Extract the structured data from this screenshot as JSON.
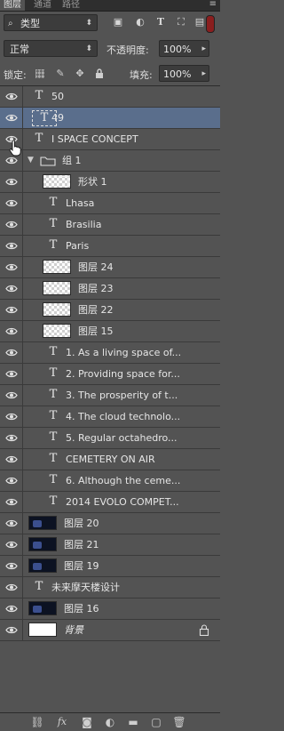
{
  "tabs": [
    {
      "label": "图层",
      "active": true
    },
    {
      "label": "通道",
      "active": false
    },
    {
      "label": "路径",
      "active": false
    }
  ],
  "panel_menu_icon": "panel-menu-icon",
  "filter": {
    "kind_label": "类型",
    "icons": [
      "pixel-filter-icon",
      "adjustment-filter-icon",
      "type-filter-icon",
      "shape-filter-icon",
      "smart-object-filter-icon"
    ]
  },
  "blend": {
    "mode": "正常",
    "opacity_label": "不透明度:",
    "opacity_value": "100%"
  },
  "lock": {
    "label": "锁定:",
    "fill_label": "填充:",
    "fill_value": "100%"
  },
  "layers": [
    {
      "kind": "text",
      "name": "50",
      "indent": 0,
      "selected": false
    },
    {
      "kind": "text",
      "name": "49",
      "indent": 0,
      "selected": true,
      "boxed": true
    },
    {
      "kind": "text",
      "name": "I  SPACE CONCEPT",
      "indent": 0,
      "selected": false
    },
    {
      "kind": "group",
      "name": "组 1",
      "indent": 0,
      "selected": false
    },
    {
      "kind": "shape",
      "name": "形状 1",
      "indent": 1,
      "selected": false
    },
    {
      "kind": "text",
      "name": "Lhasa",
      "indent": 1,
      "selected": false
    },
    {
      "kind": "text",
      "name": "Brasilia",
      "indent": 1,
      "selected": false
    },
    {
      "kind": "text",
      "name": "Paris",
      "indent": 1,
      "selected": false
    },
    {
      "kind": "image",
      "name": "图层 24",
      "indent": 1,
      "selected": false
    },
    {
      "kind": "image",
      "name": "图层 23",
      "indent": 1,
      "selected": false
    },
    {
      "kind": "image",
      "name": "图层 22",
      "indent": 1,
      "selected": false
    },
    {
      "kind": "image",
      "name": "图层 15",
      "indent": 1,
      "selected": false
    },
    {
      "kind": "text",
      "name": "1. As a living space of...",
      "indent": 1,
      "selected": false
    },
    {
      "kind": "text",
      "name": "2. Providing space for...",
      "indent": 1,
      "selected": false
    },
    {
      "kind": "text",
      "name": "3. The prosperity of t...",
      "indent": 1,
      "selected": false
    },
    {
      "kind": "text",
      "name": "4. The cloud technolo...",
      "indent": 1,
      "selected": false
    },
    {
      "kind": "text",
      "name": "5. Regular octahedro...",
      "indent": 1,
      "selected": false
    },
    {
      "kind": "text",
      "name": "CEMETERY ON AIR",
      "indent": 1,
      "selected": false
    },
    {
      "kind": "text",
      "name": "6. Although the ceme...",
      "indent": 1,
      "selected": false
    },
    {
      "kind": "text",
      "name": "2014 EVOLO COMPET...",
      "indent": 1,
      "selected": false
    },
    {
      "kind": "photo",
      "name": "图层 20",
      "indent": 0,
      "selected": false
    },
    {
      "kind": "photo",
      "name": "图层 21",
      "indent": 0,
      "selected": false
    },
    {
      "kind": "photo",
      "name": "图层 19",
      "indent": 0,
      "selected": false
    },
    {
      "kind": "text",
      "name": "未来摩天楼设计",
      "indent": 0,
      "selected": false
    },
    {
      "kind": "photo",
      "name": "图层 16",
      "indent": 0,
      "selected": false
    },
    {
      "kind": "background",
      "name": "背景",
      "indent": 0,
      "selected": false,
      "locked": true
    }
  ],
  "bottom_icons": [
    "link-layers-icon",
    "fx-icon",
    "add-mask-icon",
    "adjustment-layer-icon",
    "new-group-icon",
    "new-layer-icon",
    "delete-layer-icon"
  ],
  "colors": {
    "selected_row": "#5a6e8c",
    "panel_bg": "#535353",
    "switch_red": "#8a1e1e"
  }
}
